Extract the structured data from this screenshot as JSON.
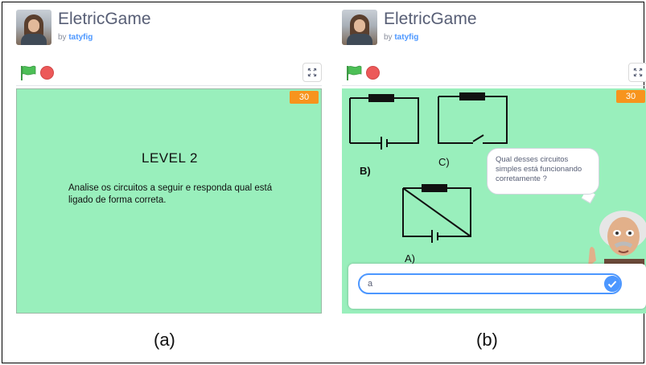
{
  "panels": [
    {
      "header": {
        "title": "EletricGame",
        "by": "by",
        "author": "tatyfig"
      },
      "counter": "30",
      "level_title": "LEVEL 2",
      "instructions": "Analise os circuitos a seguir e responda qual está ligado de forma correta.",
      "caption": "(a)"
    },
    {
      "header": {
        "title": "EletricGame",
        "by": "by",
        "author": "tatyfig"
      },
      "counter": "30",
      "circuit_labels": {
        "b": "B)",
        "c": "C)",
        "a": "A)"
      },
      "speech": "Qual desses circuitos simples está funcionando corretamente ?",
      "answer_value": "a",
      "caption": "(b)"
    }
  ],
  "icons": {
    "flag": "green-flag-icon",
    "stop": "stop-icon",
    "fullscreen": "fullscreen-icon",
    "check": "check-icon"
  },
  "colors": {
    "stage": "#99efbc",
    "counter": "#f7941d",
    "flag": "#4cbf56",
    "stop": "#ec5959",
    "accent": "#4c97ff"
  }
}
